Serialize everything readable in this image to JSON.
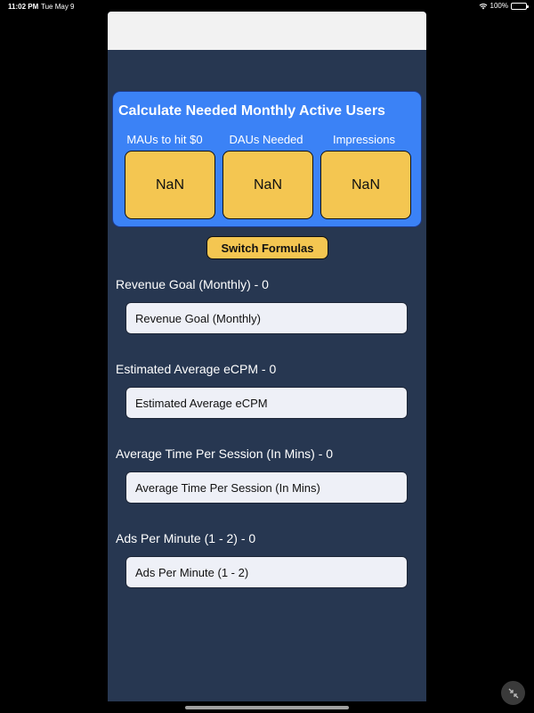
{
  "status_bar": {
    "time": "11:02 PM",
    "date": "Tue May 9",
    "battery": "100%"
  },
  "card": {
    "title": "Calculate Needed Monthly Active Users",
    "columns": [
      {
        "label": "MAUs to hit $0",
        "value": "NaN"
      },
      {
        "label": "DAUs Needed",
        "value": "NaN"
      },
      {
        "label": "Impressions",
        "value": "NaN"
      }
    ]
  },
  "switch_button": "Switch Formulas",
  "fields": [
    {
      "label": "Revenue Goal (Monthly) - 0",
      "placeholder": "Revenue Goal (Monthly)"
    },
    {
      "label": "Estimated Average eCPM - 0",
      "placeholder": "Estimated Average eCPM"
    },
    {
      "label": "Average Time Per Session (In Mins) - 0",
      "placeholder": "Average Time Per Session (In Mins)"
    },
    {
      "label": "Ads Per Minute (1 - 2) - 0",
      "placeholder": "Ads Per Minute (1 - 2)"
    }
  ],
  "colors": {
    "background": "#273751",
    "card": "#3b82f6",
    "accent": "#f4c651",
    "input": "#eef0f7"
  },
  "icons": {
    "wifi": "wifi-icon",
    "battery": "battery-icon",
    "collapse": "collapse-icon"
  }
}
